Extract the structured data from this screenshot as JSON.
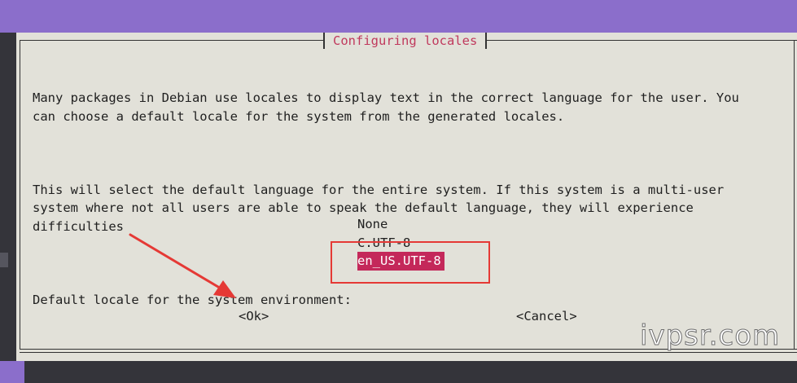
{
  "dialog": {
    "title": "Configuring locales",
    "paragraphs": [
      "Many packages in Debian use locales to display text in the correct language for the user. You\ncan choose a default locale for the system from the generated locales.",
      "This will select the default language for the entire system. If this system is a multi-user\nsystem where not all users are able to speak the default language, they will experience\ndifficulties",
      "Default locale for the system environment:"
    ],
    "options": [
      "None",
      "C.UTF-8",
      "en_US.UTF-8"
    ],
    "selected_option": "en_US.UTF-8",
    "buttons": {
      "ok": "<Ok>",
      "cancel": "<Cancel>"
    }
  },
  "annotations": {
    "highlight_color": "#e53935",
    "arrow_color": "#e53935"
  },
  "watermark": "ivpsr.com",
  "colors": {
    "terminal_top": "#8b6ecb",
    "dialog_bg": "#e2e1d9",
    "title_color": "#c0395d",
    "selection_bg": "#c4285a"
  }
}
